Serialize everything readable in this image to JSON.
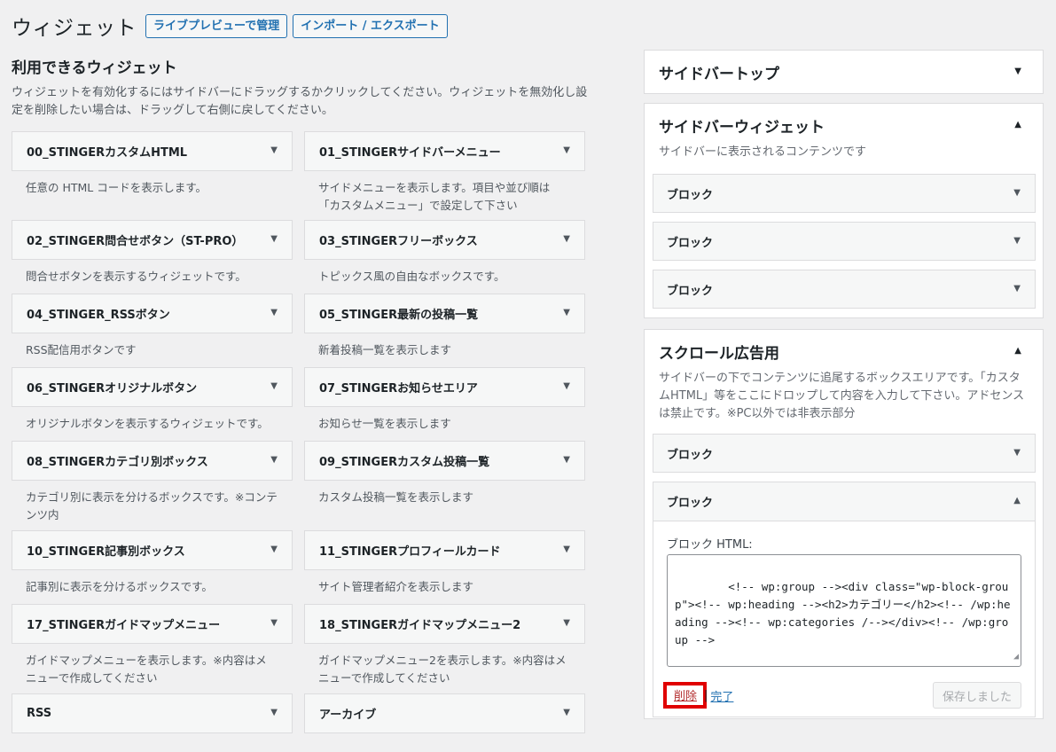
{
  "header": {
    "title": "ウィジェット",
    "live_preview_button": "ライブプレビューで管理",
    "import_export_button": "インポート / エクスポート"
  },
  "available": {
    "title": "利用できるウィジェット",
    "description": "ウィジェットを有効化するにはサイドバーにドラッグするかクリックしてください。ウィジェットを無効化し設定を削除したい場合は、ドラッグして右側に戻してください。",
    "widgets": [
      {
        "name": "00_STINGERカスタムHTML",
        "desc": "任意の HTML コードを表示します。"
      },
      {
        "name": "01_STINGERサイドバーメニュー",
        "desc": "サイドメニューを表示します。項目や並び順は「カスタムメニュー」で設定して下さい"
      },
      {
        "name": "02_STINGER問合せボタン（ST-PRO）",
        "desc": "問合せボタンを表示するウィジェットです。"
      },
      {
        "name": "03_STINGERフリーボックス",
        "desc": "トピックス風の自由なボックスです。"
      },
      {
        "name": "04_STINGER_RSSボタン",
        "desc": "RSS配信用ボタンです"
      },
      {
        "name": "05_STINGER最新の投稿一覧",
        "desc": "新着投稿一覧を表示します"
      },
      {
        "name": "06_STINGERオリジナルボタン",
        "desc": "オリジナルボタンを表示するウィジェットです。"
      },
      {
        "name": "07_STINGERお知らせエリア",
        "desc": "お知らせ一覧を表示します"
      },
      {
        "name": "08_STINGERカテゴリ別ボックス",
        "desc": "カテゴリ別に表示を分けるボックスです。※コンテンツ内"
      },
      {
        "name": "09_STINGERカスタム投稿一覧",
        "desc": "カスタム投稿一覧を表示します"
      },
      {
        "name": "10_STINGER記事別ボックス",
        "desc": "記事別に表示を分けるボックスです。"
      },
      {
        "name": "11_STINGERプロフィールカード",
        "desc": "サイト管理者紹介を表示します"
      },
      {
        "name": "17_STINGERガイドマップメニュー",
        "desc": "ガイドマップメニューを表示します。※内容はメニューで作成してください"
      },
      {
        "name": "18_STINGERガイドマップメニュー2",
        "desc": "ガイドマップメニュー2を表示します。※内容はメニューで作成してください"
      },
      {
        "name": "RSS",
        "desc": ""
      },
      {
        "name": "アーカイブ",
        "desc": ""
      }
    ]
  },
  "sidebars": {
    "top": {
      "title": "サイドバートップ"
    },
    "widget": {
      "title": "サイドバーウィジェット",
      "description": "サイドバーに表示されるコンテンツです",
      "blocks": [
        "ブロック",
        "ブロック",
        "ブロック"
      ]
    },
    "scroll": {
      "title": "スクロール広告用",
      "description": "サイドバーの下でコンテンツに追尾するボックスエリアです。「カスタムHTML」等をここにドロップして内容を入力して下さい。アドセンスは禁止です。※PC以外では非表示部分",
      "block_collapsed": "ブロック",
      "block_open": {
        "title": "ブロック",
        "field_label": "ブロック HTML:",
        "code": "<!-- wp:group --><div class=\"wp-block-group\"><!-- wp:heading --><h2>カテゴリー</h2><!-- /wp:heading --><!-- wp:categories /--></div><!-- /wp:group -->",
        "delete_link": "削除",
        "separator": "|",
        "done_link": "完了",
        "save_button": "保存しました"
      }
    }
  },
  "icons": {
    "arrow_down": "▼",
    "arrow_up": "▲",
    "resize_grip": "◢"
  },
  "colors": {
    "accent": "#2271b1",
    "delete": "#b32d2e",
    "highlight_border": "#e00000"
  }
}
